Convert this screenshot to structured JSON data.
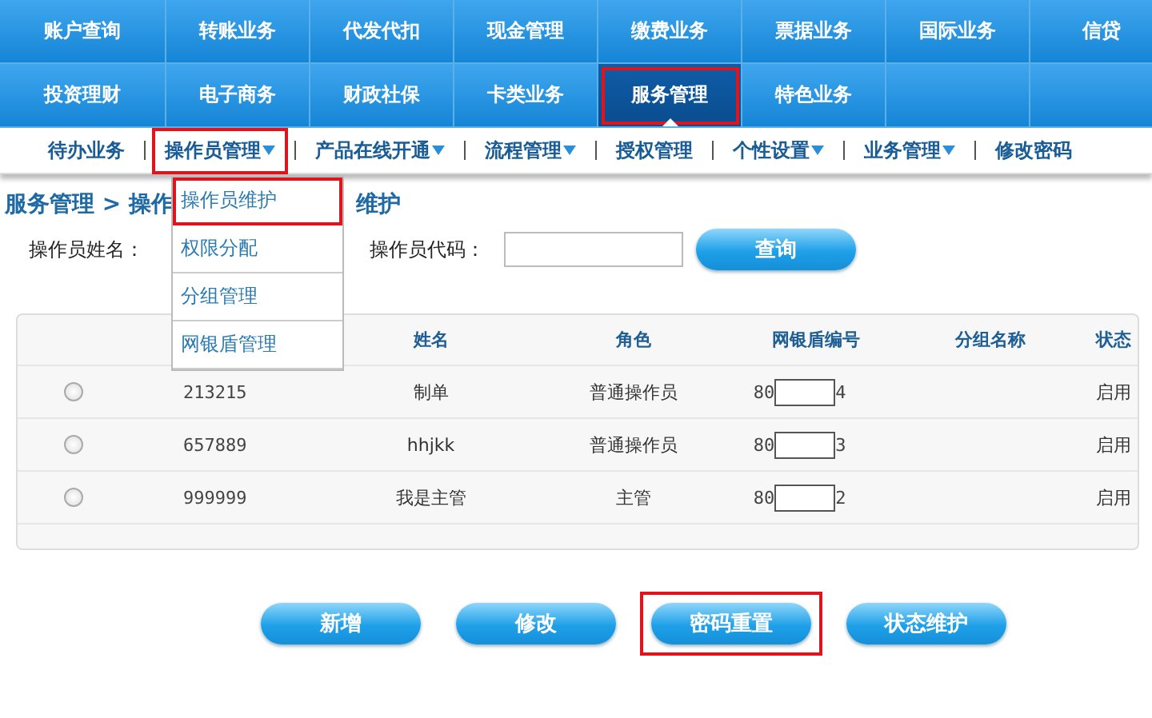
{
  "main_nav": [
    {
      "label": "账户查询",
      "selected": false,
      "highlighted": false
    },
    {
      "label": "转账业务",
      "selected": false,
      "highlighted": false
    },
    {
      "label": "代发代扣",
      "selected": false,
      "highlighted": false
    },
    {
      "label": "现金管理",
      "selected": false,
      "highlighted": false
    },
    {
      "label": "缴费业务",
      "selected": false,
      "highlighted": false
    },
    {
      "label": "票据业务",
      "selected": false,
      "highlighted": false
    },
    {
      "label": "国际业务",
      "selected": false,
      "highlighted": false
    },
    {
      "label": "信贷",
      "selected": false,
      "highlighted": false
    },
    {
      "label": "投资理财",
      "selected": false,
      "highlighted": false
    },
    {
      "label": "电子商务",
      "selected": false,
      "highlighted": false
    },
    {
      "label": "财政社保",
      "selected": false,
      "highlighted": false
    },
    {
      "label": "卡类业务",
      "selected": false,
      "highlighted": false
    },
    {
      "label": "服务管理",
      "selected": true,
      "highlighted": true
    },
    {
      "label": "特色业务",
      "selected": false,
      "highlighted": false
    }
  ],
  "sub_nav": [
    {
      "label": "待办业务",
      "has_menu": false,
      "highlighted": false
    },
    {
      "label": "操作员管理",
      "has_menu": true,
      "highlighted": true
    },
    {
      "label": "产品在线开通",
      "has_menu": true,
      "highlighted": false
    },
    {
      "label": "流程管理",
      "has_menu": true,
      "highlighted": false
    },
    {
      "label": "授权管理",
      "has_menu": false,
      "highlighted": false
    },
    {
      "label": "个性设置",
      "has_menu": true,
      "highlighted": false
    },
    {
      "label": "业务管理",
      "has_menu": true,
      "highlighted": false
    },
    {
      "label": "修改密码",
      "has_menu": false,
      "highlighted": false
    }
  ],
  "dropdown": [
    {
      "label": "操作员维护",
      "highlighted": true
    },
    {
      "label": "权限分配",
      "highlighted": false
    },
    {
      "label": "分组管理",
      "highlighted": false
    },
    {
      "label": "网银盾管理",
      "highlighted": false
    }
  ],
  "breadcrumb": {
    "left": "服务管理 > 操作",
    "right": "维护"
  },
  "search": {
    "name_label": "操作员姓名：",
    "code_label": "操作员代码：",
    "button": "查询"
  },
  "table": {
    "columns": [
      "姓名",
      "角色",
      "网银盾编号",
      "分组名称",
      "状态"
    ],
    "rows": [
      {
        "selected": false,
        "code": "213215",
        "name": "制单",
        "role": "普通操作员",
        "key_prefix": "80",
        "key_suffix": "4",
        "status": "启用"
      },
      {
        "selected": false,
        "code": "657889",
        "name": "hhjkk",
        "role": "普通操作员",
        "key_prefix": "80",
        "key_suffix": "3",
        "status": "启用"
      },
      {
        "selected": false,
        "code": "999999",
        "name": "我是主管",
        "role": "主管",
        "key_prefix": "80",
        "key_suffix": "2",
        "status": "启用"
      }
    ]
  },
  "actions": [
    {
      "label": "新增",
      "highlighted": false
    },
    {
      "label": "修改",
      "highlighted": false
    },
    {
      "label": "密码重置",
      "highlighted": true
    },
    {
      "label": "状态维护",
      "highlighted": false
    }
  ]
}
